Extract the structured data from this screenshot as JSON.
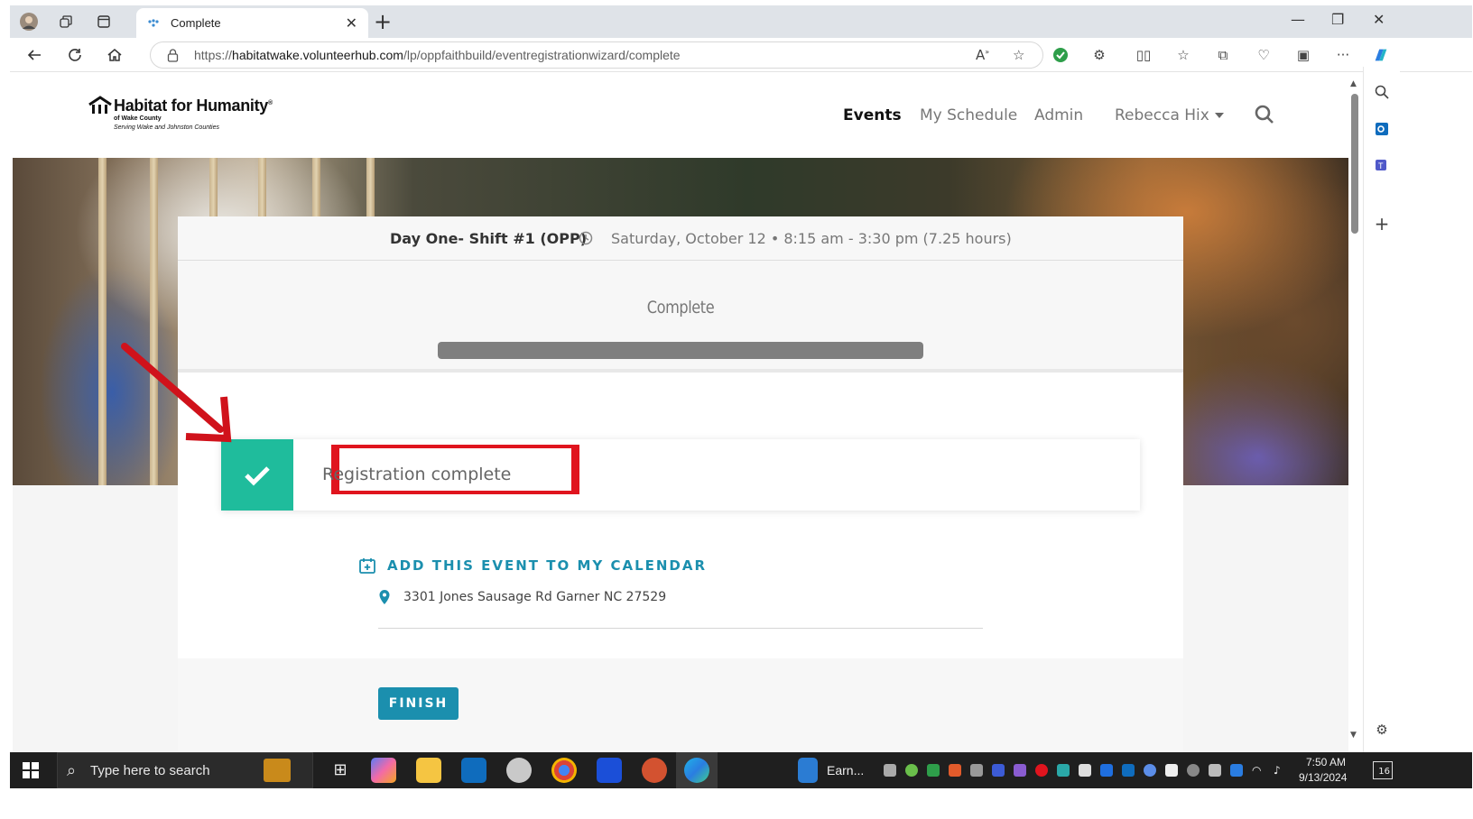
{
  "browser": {
    "tab_title": "Complete",
    "url_prefix": "https://",
    "url_domain": "habitatwake.volunteerhub.com",
    "url_path": "/lp/oppfaithbuild/eventregistrationwizard/complete"
  },
  "site": {
    "logo_name": "Habitat for Humanity",
    "logo_reg": "®",
    "logo_sub1": "of Wake County",
    "logo_sub2": "Serving Wake and Johnston Counties",
    "nav": {
      "events": "Events",
      "my_schedule": "My Schedule",
      "admin": "Admin",
      "user": "Rebecca Hix"
    }
  },
  "event": {
    "name": "Day One- Shift #1 (OPP)",
    "time": "Saturday, October 12 • 8:15 am - 3:30 pm (7.25 hours)"
  },
  "wizard": {
    "step_title": "Complete",
    "progress_percent": 100
  },
  "alert": {
    "message": "Registration complete"
  },
  "calendar_link": "ADD THIS EVENT TO MY CALENDAR",
  "address": "3301 Jones Sausage Rd Garner NC 27529",
  "finish_label": "FINISH",
  "taskbar": {
    "search_placeholder": "Type here to search",
    "window_label": "Earn...",
    "time": "7:50 AM",
    "date": "9/13/2024",
    "notifications": "16"
  },
  "colors": {
    "teal_accent": "#1b8fae",
    "success_green": "#1fbc9c",
    "highlight_red": "#e0141e"
  }
}
